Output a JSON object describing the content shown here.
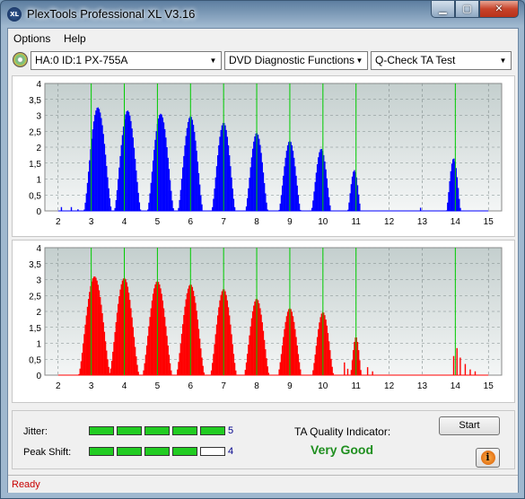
{
  "window": {
    "title": "PlexTools Professional XL V3.16",
    "app_icon_text": "XL",
    "minimize_glyph": "▁",
    "maximize_glyph": "▢",
    "close_glyph": "✕"
  },
  "menu": [
    "Options",
    "Help"
  ],
  "toolbar": {
    "drive": "HA:0 ID:1  PX-755A",
    "function": "DVD Diagnostic Functions",
    "test": "Q-Check TA Test"
  },
  "colors": {
    "upper_series": "#0000ff",
    "lower_series": "#ff0000",
    "marker_lines": "#00cc00",
    "plot_background_top": "#c4cfce",
    "plot_background_bottom": "#f4f6f6"
  },
  "chart_data": [
    {
      "type": "bar",
      "title": "",
      "series_name": "",
      "xlim": [
        1.6,
        15.4
      ],
      "ylim": [
        0,
        4
      ],
      "x_ticks": [
        "2",
        "3",
        "4",
        "5",
        "6",
        "7",
        "8",
        "9",
        "10",
        "11",
        "12",
        "13",
        "14",
        "15"
      ],
      "y_ticks": [
        "0",
        "0,5",
        "1",
        "1,5",
        "2",
        "2,5",
        "3",
        "3,5",
        "4"
      ],
      "markers": [
        3,
        4,
        5,
        6,
        7,
        8,
        9,
        10,
        11,
        14
      ],
      "peaks": [
        {
          "center": 3.2,
          "height": 3.25,
          "width": 0.42
        },
        {
          "center": 4.1,
          "height": 3.15,
          "width": 0.4
        },
        {
          "center": 5.1,
          "height": 3.05,
          "width": 0.4
        },
        {
          "center": 6.0,
          "height": 2.97,
          "width": 0.38
        },
        {
          "center": 7.0,
          "height": 2.77,
          "width": 0.36
        },
        {
          "center": 8.0,
          "height": 2.45,
          "width": 0.34
        },
        {
          "center": 9.0,
          "height": 2.2,
          "width": 0.33
        },
        {
          "center": 9.95,
          "height": 1.95,
          "width": 0.3
        },
        {
          "center": 10.95,
          "height": 1.28,
          "width": 0.2
        },
        {
          "center": 13.95,
          "height": 1.65,
          "width": 0.22
        }
      ],
      "noise": [
        [
          2.1,
          0.12
        ],
        [
          2.4,
          0.12
        ],
        [
          2.6,
          0.05
        ],
        [
          12.95,
          0.1
        ]
      ]
    },
    {
      "type": "bar",
      "title": "",
      "series_name": "",
      "xlim": [
        1.6,
        15.4
      ],
      "ylim": [
        0,
        4
      ],
      "x_ticks": [
        "2",
        "3",
        "4",
        "5",
        "6",
        "7",
        "8",
        "9",
        "10",
        "11",
        "12",
        "13",
        "14",
        "15"
      ],
      "y_ticks": [
        "0",
        "0,5",
        "1",
        "1,5",
        "2",
        "2,5",
        "3",
        "3,5",
        "4"
      ],
      "markers": [
        3,
        4,
        5,
        6,
        7,
        8,
        9,
        10,
        11,
        14
      ],
      "peaks": [
        {
          "center": 3.1,
          "height": 3.1,
          "width": 0.48
        },
        {
          "center": 4.0,
          "height": 3.05,
          "width": 0.45
        },
        {
          "center": 5.0,
          "height": 2.95,
          "width": 0.45
        },
        {
          "center": 6.0,
          "height": 2.85,
          "width": 0.43
        },
        {
          "center": 7.0,
          "height": 2.7,
          "width": 0.4
        },
        {
          "center": 8.0,
          "height": 2.4,
          "width": 0.38
        },
        {
          "center": 9.0,
          "height": 2.1,
          "width": 0.36
        },
        {
          "center": 10.0,
          "height": 1.98,
          "width": 0.33
        },
        {
          "center": 11.0,
          "height": 1.2,
          "width": 0.17
        }
      ],
      "noise": [
        [
          10.65,
          0.4
        ],
        [
          10.75,
          0.2
        ],
        [
          11.35,
          0.25
        ],
        [
          11.5,
          0.12
        ],
        [
          13.95,
          0.6
        ],
        [
          14.05,
          0.85
        ],
        [
          14.15,
          0.55
        ],
        [
          14.3,
          0.35
        ],
        [
          14.45,
          0.18
        ],
        [
          14.6,
          0.12
        ]
      ]
    }
  ],
  "bottom": {
    "jitter_label": "Jitter:",
    "jitter_value": "5",
    "jitter_level": 5,
    "peak_shift_label": "Peak Shift:",
    "peak_shift_value": "4",
    "peak_shift_level": 4,
    "segments_total": 5,
    "quality_label": "TA Quality Indicator:",
    "quality_value": "Very Good",
    "start_button": "Start",
    "info_icon_glyph": "i"
  },
  "status": "Ready"
}
